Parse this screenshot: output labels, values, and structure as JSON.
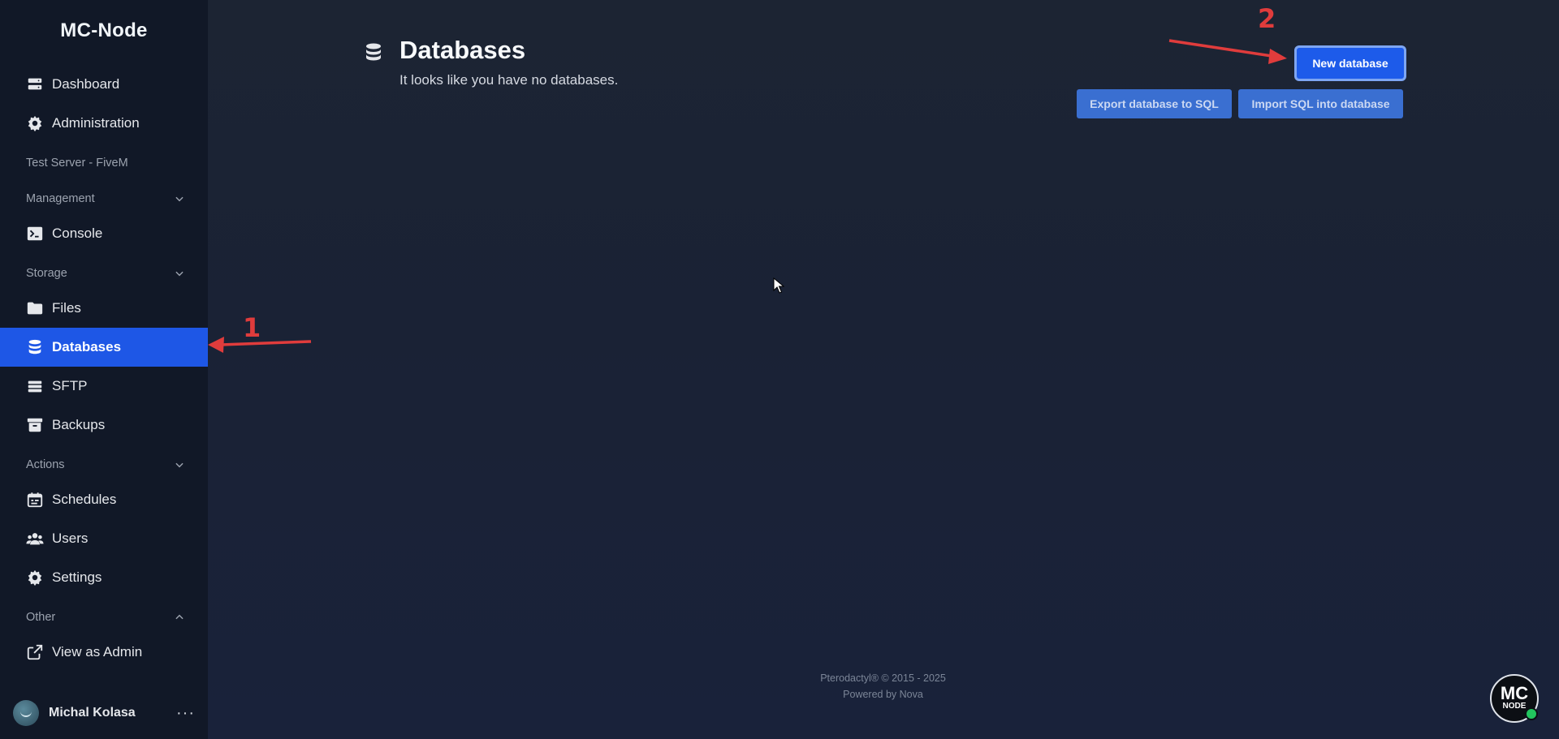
{
  "app": {
    "brand": "MC-Node"
  },
  "sidebar": {
    "top_items": [
      {
        "label": "Dashboard",
        "icon": "server-icon"
      },
      {
        "label": "Administration",
        "icon": "gear-icon"
      }
    ],
    "server_name": "Test Server - FiveM",
    "sections": {
      "management": "Management",
      "storage": "Storage",
      "actions": "Actions",
      "other": "Other"
    },
    "items": {
      "console": "Console",
      "files": "Files",
      "databases": "Databases",
      "sftp": "SFTP",
      "backups": "Backups",
      "schedules": "Schedules",
      "users": "Users",
      "settings": "Settings",
      "view_as_admin": "View as Admin"
    },
    "active_item": "Databases",
    "user": {
      "name": "Michal Kolasa",
      "menu": "···"
    }
  },
  "main": {
    "title": "Databases",
    "subtitle": "It looks like you have no databases.",
    "buttons": {
      "new_database": "New database",
      "export_sql": "Export database to SQL",
      "import_sql": "Import SQL into database"
    }
  },
  "footer": {
    "line1": "Pterodactyl® © 2015 - 2025",
    "line2": "Powered by Nova"
  },
  "annotations": {
    "marker1": "1",
    "marker2": "2"
  },
  "badge": {
    "line1": "MC",
    "line2": "NODE"
  },
  "colors": {
    "accent": "#1e57e6",
    "sidebar_bg": "#111827",
    "annotation": "#e03c3c",
    "online": "#22c55e"
  }
}
